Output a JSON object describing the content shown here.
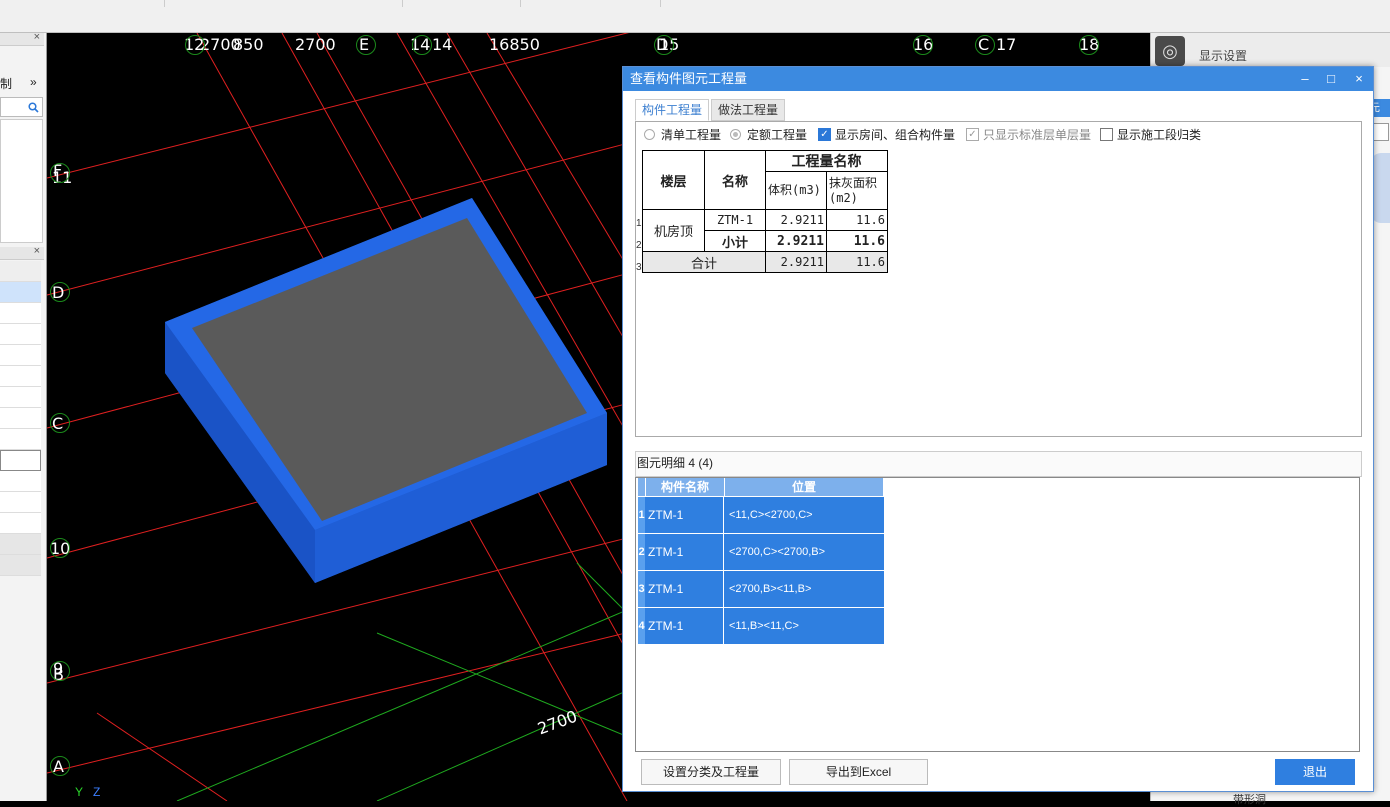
{
  "left_panel": {
    "close1": "×",
    "label_zhi": "制",
    "more": "»",
    "close2": "×"
  },
  "axis_labels": {
    "top": [
      "12",
      "2700",
      "850",
      "2700",
      "E",
      "14",
      "14",
      "16850",
      "D",
      "15",
      "16",
      "C",
      "17",
      "18"
    ],
    "left": [
      "F",
      "11",
      "D",
      "C",
      "10",
      "9",
      "B",
      "A"
    ],
    "bottom_dim": "2700",
    "axes": [
      "Y",
      "Z"
    ]
  },
  "right_panel": {
    "title": "显示设置",
    "partial": "元",
    "partial_bottom": "带形洞"
  },
  "dialog": {
    "title": "查看构件图元工程量",
    "controls": {
      "minimize": "–",
      "maximize": "□",
      "close": "×"
    },
    "tabs": [
      "构件工程量",
      "做法工程量"
    ],
    "options": {
      "qingdan": "清单工程量",
      "dinge": "定额工程量",
      "show_room": "显示房间、组合构件量",
      "only_std": "只显示标准层单层量",
      "show_stage": "显示施工段归类"
    },
    "table": {
      "h_floor": "楼层",
      "h_name": "名称",
      "h_group": "工程量名称",
      "h_vol": "体积(m3)",
      "h_plaster": "抹灰面积(m2)",
      "floor": "机房顶",
      "rows": [
        {
          "idx": "1",
          "name": "ZTM-1",
          "vol": "2.9211",
          "plaster": "11.6"
        },
        {
          "idx": "2",
          "name": "小计",
          "vol": "2.9211",
          "plaster": "11.6"
        }
      ],
      "total": {
        "idx": "3",
        "label": "合计",
        "vol": "2.9211",
        "plaster": "11.6"
      }
    },
    "detail": {
      "label": "图元明细  4 (4)",
      "h_name": "构件名称",
      "h_pos": "位置",
      "rows": [
        {
          "idx": "1",
          "name": "ZTM-1",
          "pos": "<11,C><2700,C>"
        },
        {
          "idx": "2",
          "name": "ZTM-1",
          "pos": "<2700,C><2700,B>"
        },
        {
          "idx": "3",
          "name": "ZTM-1",
          "pos": "<2700,B><11,B>"
        },
        {
          "idx": "4",
          "name": "ZTM-1",
          "pos": "<11,B><11,C>"
        }
      ]
    },
    "buttons": {
      "set_class": "设置分类及工程量",
      "export": "导出到Excel",
      "exit": "退出"
    }
  }
}
